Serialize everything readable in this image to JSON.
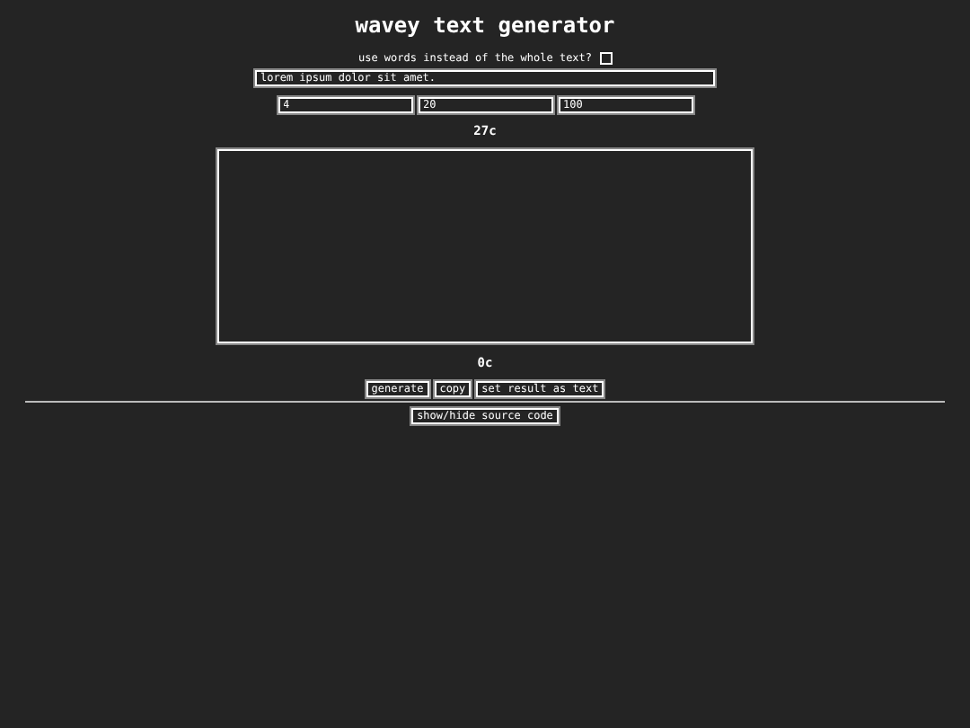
{
  "title": "wavey text generator",
  "words_option": {
    "label": "use words instead of the whole text?",
    "checked": false
  },
  "text_input": {
    "value": "lorem ipsum dolor sit amet."
  },
  "number_inputs": [
    {
      "value": "4"
    },
    {
      "value": "20"
    },
    {
      "value": "100"
    }
  ],
  "input_count": "27c",
  "result_count": "0c",
  "buttons": [
    "generate",
    "copy",
    "set result as text"
  ],
  "source_button": "show/hide source code"
}
